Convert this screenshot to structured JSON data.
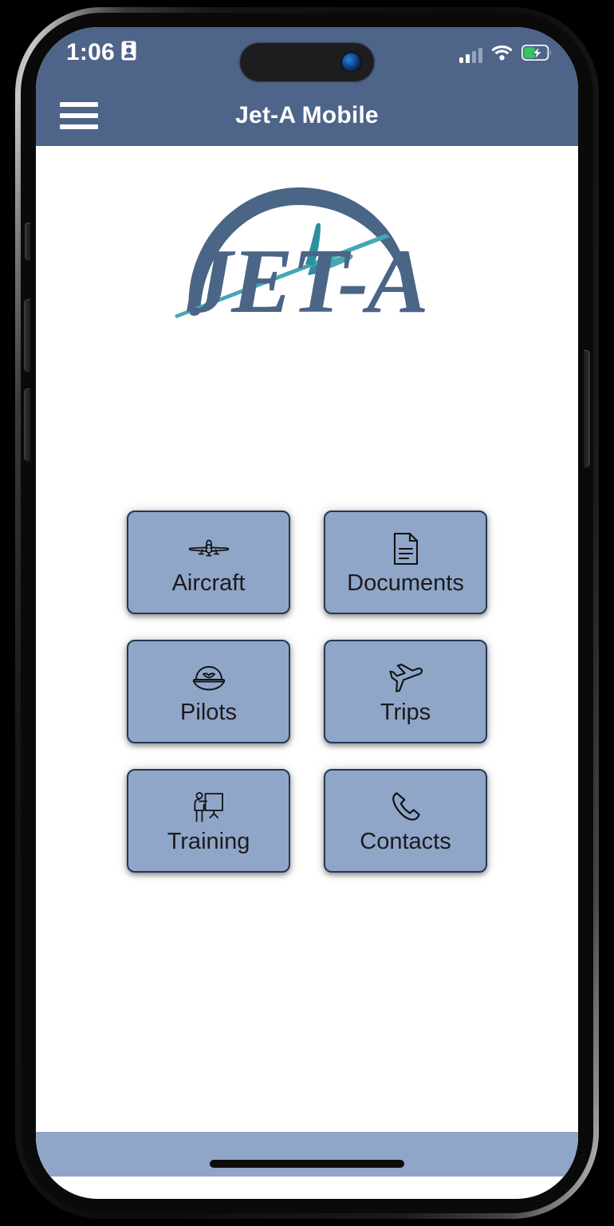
{
  "status_bar": {
    "time": "1:06",
    "badge_icon": "id-badge-icon",
    "cellular_icon": "cellular-signal-icon",
    "cellular_bars_filled": 2,
    "cellular_bars_total": 4,
    "wifi_icon": "wifi-icon",
    "battery_icon": "battery-charging-icon",
    "battery_charging": true,
    "dynamic_island_camera": "camera-lens-icon"
  },
  "header": {
    "menu_icon": "hamburger-menu-icon",
    "title": "Jet-A Mobile"
  },
  "logo": {
    "wordmark": "JET-A",
    "arc_icon": "arc-swoosh-icon",
    "plane_icon": "glider-plane-icon"
  },
  "menu": {
    "tiles": [
      {
        "label": "Aircraft",
        "icon": "airplane-front-icon"
      },
      {
        "label": "Documents",
        "icon": "document-icon"
      },
      {
        "label": "Pilots",
        "icon": "pilot-cap-icon"
      },
      {
        "label": "Trips",
        "icon": "airplane-takeoff-icon"
      },
      {
        "label": "Training",
        "icon": "presenter-whiteboard-icon"
      },
      {
        "label": "Contacts",
        "icon": "phone-handset-icon"
      }
    ]
  },
  "bottom": {
    "home_indicator": "home-indicator"
  },
  "colors": {
    "header_blue": "#4E6489",
    "tile_blue": "#90A6C8",
    "tile_border": "#243855",
    "logo_slate": "#4A6585",
    "logo_teal": "#3E9BAA",
    "battery_green": "#34C759",
    "screen_white": "#FFFFFF"
  }
}
